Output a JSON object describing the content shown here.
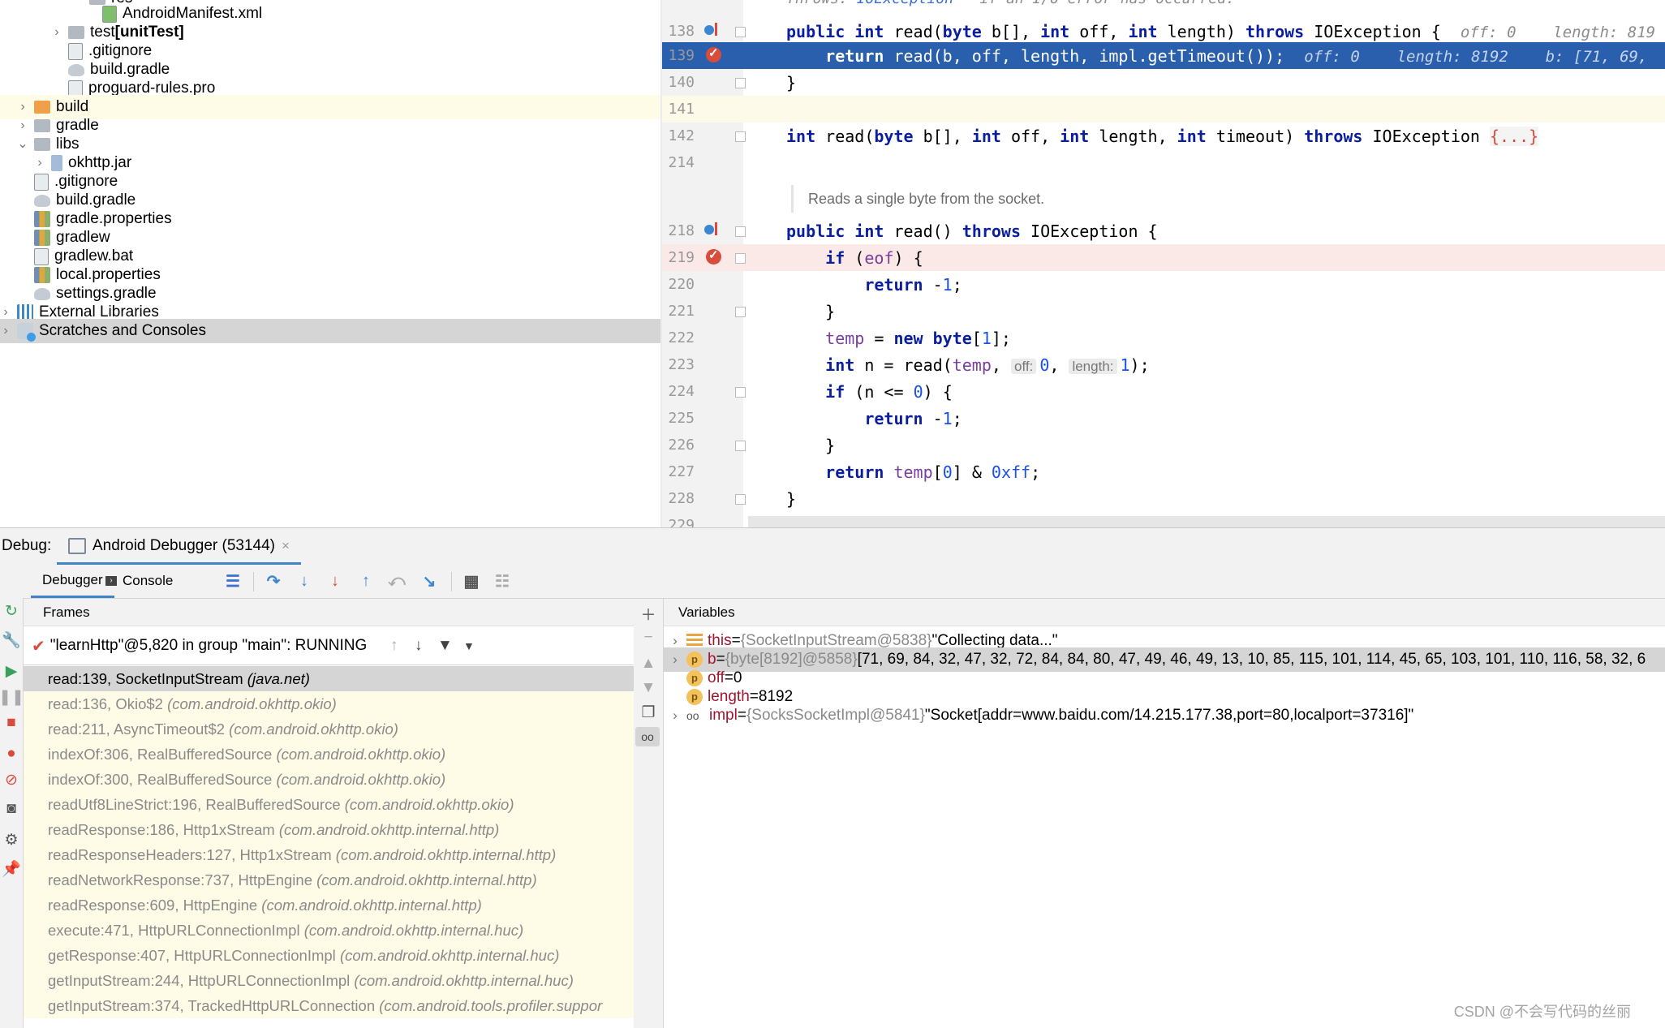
{
  "project_tree": {
    "items": [
      {
        "label": "AndroidManifest.xml",
        "bold": "",
        "indent": 5,
        "arrow": "",
        "icon": "mf"
      },
      {
        "label": "test ",
        "bold": "[unitTest]",
        "indent": 3,
        "arrow": "›",
        "icon": "folder"
      },
      {
        "label": ".gitignore",
        "bold": "",
        "indent": 3,
        "arrow": "",
        "icon": "file"
      },
      {
        "label": "build.gradle",
        "bold": "",
        "indent": 3,
        "arrow": "",
        "icon": "gradle"
      },
      {
        "label": "proguard-rules.pro",
        "bold": "",
        "indent": 3,
        "arrow": "",
        "icon": "file"
      },
      {
        "label": "build",
        "bold": "",
        "indent": 1,
        "arrow": "›",
        "icon": "folder-orange"
      },
      {
        "label": "gradle",
        "bold": "",
        "indent": 1,
        "arrow": "›",
        "icon": "folder"
      },
      {
        "label": "libs",
        "bold": "",
        "indent": 1,
        "arrow": "⌄",
        "icon": "folder"
      },
      {
        "label": "okhttp.jar",
        "bold": "",
        "indent": 2,
        "arrow": "›",
        "icon": "jar"
      },
      {
        "label": ".gitignore",
        "bold": "",
        "indent": 1,
        "arrow": "",
        "icon": "file"
      },
      {
        "label": "build.gradle",
        "bold": "",
        "indent": 1,
        "arrow": "",
        "icon": "gradle"
      },
      {
        "label": "gradle.properties",
        "bold": "",
        "indent": 1,
        "arrow": "",
        "icon": "props"
      },
      {
        "label": "gradlew",
        "bold": "",
        "indent": 1,
        "arrow": "",
        "icon": "props"
      },
      {
        "label": "gradlew.bat",
        "bold": "",
        "indent": 1,
        "arrow": "",
        "icon": "file"
      },
      {
        "label": "local.properties",
        "bold": "",
        "indent": 1,
        "arrow": "",
        "icon": "props"
      },
      {
        "label": "settings.gradle",
        "bold": "",
        "indent": 1,
        "arrow": "",
        "icon": "gradle"
      },
      {
        "label": "External Libraries",
        "bold": "",
        "indent": 0,
        "arrow": "›",
        "icon": "libs"
      },
      {
        "label": "Scratches and Consoles",
        "bold": "",
        "indent": 0,
        "arrow": "›",
        "icon": "scratch"
      }
    ]
  },
  "editor": {
    "top_comment": "Throws: IOException - if an I/O error has occurred.",
    "doc_comment": "Reads a single byte from the socket.",
    "line_numbers": [
      "138",
      "139",
      "140",
      "141",
      "142",
      "214",
      "218",
      "219",
      "220",
      "221",
      "222",
      "223",
      "224",
      "225",
      "226",
      "227",
      "228",
      "229"
    ]
  },
  "debug": {
    "label": "Debug:",
    "run_tab": "Android Debugger (53144)",
    "tabs": {
      "debugger": "Debugger",
      "console": "Console"
    },
    "frames_title": "Frames",
    "variables_title": "Variables",
    "thread": "\"learnHttp\"@5,820 in group \"main\": RUNNING",
    "frames": [
      {
        "method": "read:139, SocketInputStream ",
        "pkg": "(java.net)"
      },
      {
        "method": "read:136, Okio$2 ",
        "pkg": "(com.android.okhttp.okio)"
      },
      {
        "method": "read:211, AsyncTimeout$2 ",
        "pkg": "(com.android.okhttp.okio)"
      },
      {
        "method": "indexOf:306, RealBufferedSource ",
        "pkg": "(com.android.okhttp.okio)"
      },
      {
        "method": "indexOf:300, RealBufferedSource ",
        "pkg": "(com.android.okhttp.okio)"
      },
      {
        "method": "readUtf8LineStrict:196, RealBufferedSource ",
        "pkg": "(com.android.okhttp.okio)"
      },
      {
        "method": "readResponse:186, Http1xStream ",
        "pkg": "(com.android.okhttp.internal.http)"
      },
      {
        "method": "readResponseHeaders:127, Http1xStream ",
        "pkg": "(com.android.okhttp.internal.http)"
      },
      {
        "method": "readNetworkResponse:737, HttpEngine ",
        "pkg": "(com.android.okhttp.internal.http)"
      },
      {
        "method": "readResponse:609, HttpEngine ",
        "pkg": "(com.android.okhttp.internal.http)"
      },
      {
        "method": "execute:471, HttpURLConnectionImpl ",
        "pkg": "(com.android.okhttp.internal.huc)"
      },
      {
        "method": "getResponse:407, HttpURLConnectionImpl ",
        "pkg": "(com.android.okhttp.internal.huc)"
      },
      {
        "method": "getInputStream:244, HttpURLConnectionImpl ",
        "pkg": "(com.android.okhttp.internal.huc)"
      },
      {
        "method": "getInputStream:374, TrackedHttpURLConnection ",
        "pkg": "(com.android.tools.profiler.suppor"
      }
    ],
    "variables": [
      {
        "name": "this",
        "eq": " = ",
        "type": "{SocketInputStream@5838} ",
        "value": "\"Collecting data...\"",
        "icon": "this",
        "expandable": true
      },
      {
        "name": "b",
        "eq": " = ",
        "type": "{byte[8192]@5858} ",
        "value": "[71, 69, 84, 32, 47, 32, 72, 84, 84, 80, 47, 49, 46, 49, 13, 10, 85, 115, 101, 114, 45, 65, 103, 101, 110, 116, 58, 32, 6",
        "icon": "p",
        "expandable": true
      },
      {
        "name": "off",
        "eq": " = ",
        "type": "",
        "value": "0",
        "icon": "p",
        "expandable": false
      },
      {
        "name": "length",
        "eq": " = ",
        "type": "",
        "value": "8192",
        "icon": "p",
        "expandable": false
      },
      {
        "name": "impl",
        "eq": " = ",
        "type": "{SocksSocketImpl@5841} ",
        "value": "\"Socket[addr=www.baidu.com/14.215.177.38,port=80,localport=37316]\"",
        "icon": "oo",
        "expandable": true
      }
    ]
  },
  "watermark": "CSDN @不会写代码的丝丽"
}
